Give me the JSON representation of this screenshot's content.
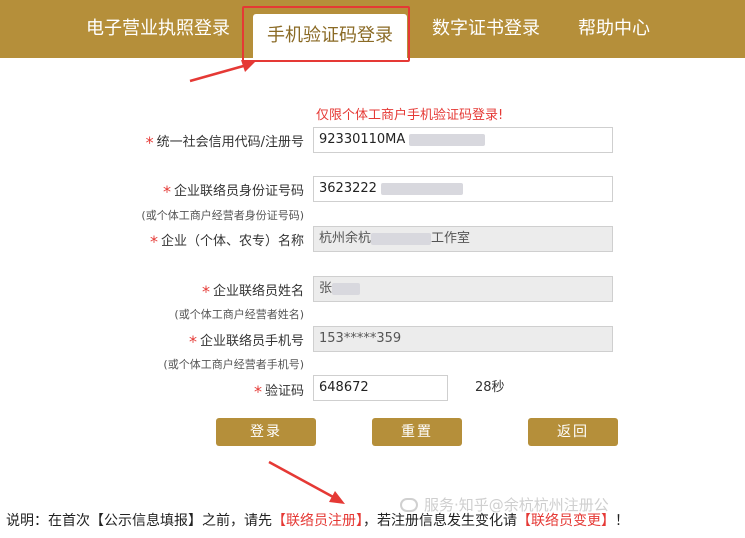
{
  "nav": {
    "tabs": [
      {
        "label": "电子营业执照登录"
      },
      {
        "label": "手机验证码登录"
      },
      {
        "label": "数字证书登录"
      },
      {
        "label": "帮助中心"
      }
    ]
  },
  "form": {
    "notice": "仅限个体工商户手机验证码登录!",
    "credit_code": {
      "label": "统一社会信用代码/注册号",
      "value": "92330110MA"
    },
    "id_number": {
      "label": "企业联络员身份证号码",
      "sublabel": "(或个体工商户经营者身份证号码)",
      "value": "3623222"
    },
    "company_name": {
      "label": "企业（个体、农专）名称",
      "value_start": "杭州余杭",
      "value_end": "工作室"
    },
    "liaison_name": {
      "label": "企业联络员姓名",
      "sublabel": "(或个体工商户经营者姓名)",
      "value": "张"
    },
    "liaison_phone": {
      "label": "企业联络员手机号",
      "sublabel": "(或个体工商户经营者手机号)",
      "value": "153*****359"
    },
    "verification": {
      "label": "验证码",
      "value": "648672",
      "countdown": "28秒"
    }
  },
  "buttons": {
    "login": "登录",
    "reset": "重置",
    "back": "返回"
  },
  "footer": {
    "prefix": "说明：在首次【公示信息填报】之前，请先",
    "register_link": "【联络员注册】",
    "middle": "，若注册信息发生变化请",
    "change_link": "【联络员变更】",
    "suffix": "！"
  },
  "watermark": "服务·知乎@余杭杭州注册公"
}
